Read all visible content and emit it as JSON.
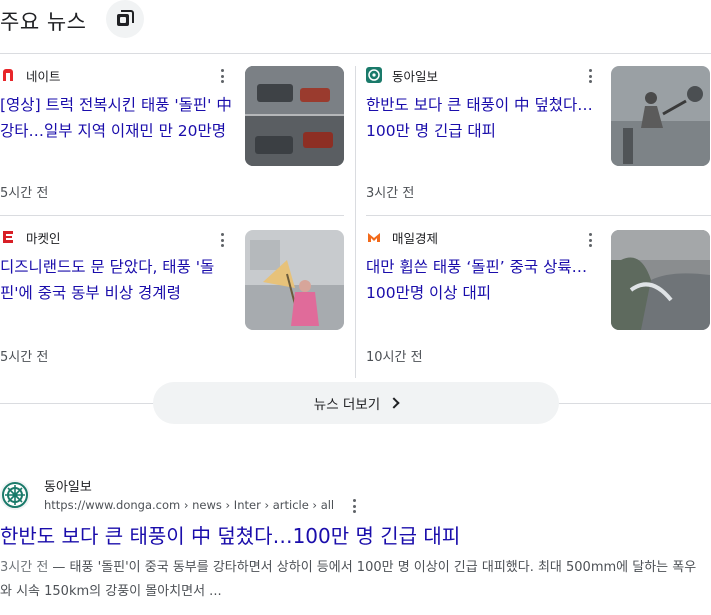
{
  "header": {
    "title": "주요 뉴스"
  },
  "cards": [
    {
      "source": "네이트",
      "title": "[영상] 트럭 전복시킨 태풍 '돌핀' 中 강타…일부 지역 이재민 만 20만명",
      "time": "5시간 전",
      "logo_color": "#e8262a"
    },
    {
      "source": "동아일보",
      "title": "한반도 보다 큰 태풍이 中 덮쳤다…100만 명 긴급 대피",
      "time": "3시간 전",
      "logo_color": "#1a7a6a"
    },
    {
      "source": "마켓인",
      "title": "디즈니랜드도 문 닫았다, 태풍 '돌핀'에 중국 동부 비상 경계령",
      "time": "5시간 전",
      "logo_color": "#d81f26"
    },
    {
      "source": "매일경제",
      "title": "대만 휩쓴 태풍 ‘돌핀’ 중국 상륙…100만명 이상 대피",
      "time": "10시간 전",
      "logo_color": "#f26a1b"
    }
  ],
  "more_button": {
    "label": "뉴스 더보기"
  },
  "result": {
    "site": "동아일보",
    "url": "https://www.donga.com › news › Inter › article › all",
    "title": "한반도 보다 큰 태풍이 中 덮쳤다…100만 명 긴급 대피",
    "time": "3시간 전",
    "snippet": " — 태풍 '돌핀'이 중국 동부를 강타하면서 상하이 등에서 100만 명 이상이 긴급 대피했다. 최대 500mm에 달하는 폭우와 시속 150km의 강풍이 몰아치면서 ..."
  }
}
